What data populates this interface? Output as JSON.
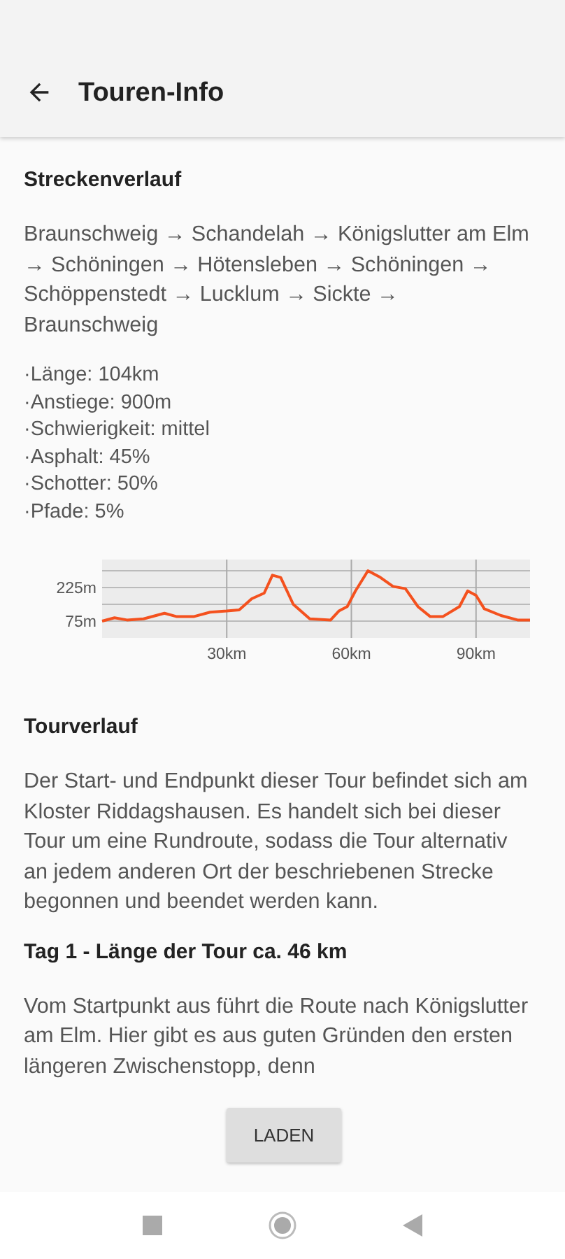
{
  "app_bar": {
    "title": "Touren-Info"
  },
  "sections": [
    {
      "kind": "heading",
      "text": "Streckenverlauf"
    },
    {
      "kind": "paragraph",
      "text": "Braunschweig → Schandelah → Königslutter am Elm → Schöningen → Hötensleben → Schöningen → Schöppenstedt → Lucklum → Sickte → Braunschweig"
    },
    {
      "kind": "list",
      "items": [
        "·Länge: 104km",
        "·Anstiege: 900m",
        "·Schwierigkeit: mittel",
        "·Asphalt: 45%",
        "·Schotter: 50%",
        "·Pfade: 5%"
      ]
    },
    {
      "kind": "chart",
      "chart_data": {
        "type": "line",
        "x": [
          0,
          3,
          6,
          10,
          15,
          18,
          22,
          26,
          30,
          33,
          36,
          39,
          41,
          43,
          46,
          50,
          55,
          57,
          59,
          61,
          64,
          67,
          70,
          73,
          76,
          79,
          82,
          86,
          88,
          90,
          92,
          96,
          100,
          103
        ],
        "grid": true,
        "series": [
          {
            "color": "#f4511e",
            "values": [
              75,
              90,
              80,
              85,
              110,
              95,
              95,
              115,
              120,
              125,
              175,
              200,
              280,
              270,
              150,
              85,
              80,
              120,
              140,
              210,
              300,
              270,
              230,
              220,
              140,
              95,
              95,
              140,
              210,
              190,
              130,
              100,
              80,
              80
            ]
          }
        ],
        "xlim": [
          0,
          103
        ],
        "ylim": [
          0,
          350
        ],
        "xticks": [
          {
            "value": 30,
            "label": "30km"
          },
          {
            "value": 60,
            "label": "60km"
          },
          {
            "value": 90,
            "label": "90km"
          }
        ],
        "yticks": [
          {
            "value": 75,
            "label": "75m"
          },
          {
            "value": 225,
            "label": "225m"
          }
        ]
      }
    },
    {
      "kind": "heading",
      "text": "Tourverlauf"
    },
    {
      "kind": "paragraph",
      "text": "Der Start- und Endpunkt dieser Tour befindet sich am Kloster Riddagshausen. Es handelt sich bei dieser Tour um eine Rundroute, sodass die Tour alternativ an jedem anderen Ort der beschriebenen Strecke begonnen und beendet werden kann."
    },
    {
      "kind": "heading",
      "text": "Tag 1 - Länge der Tour ca. 46 km"
    },
    {
      "kind": "paragraph",
      "text": "Vom Startpunkt aus führt die Route nach Königslutter am Elm. Hier gibt es aus guten Gründen den ersten längeren Zwischenstopp, denn"
    }
  ],
  "load_button": {
    "label": "LADEN"
  }
}
